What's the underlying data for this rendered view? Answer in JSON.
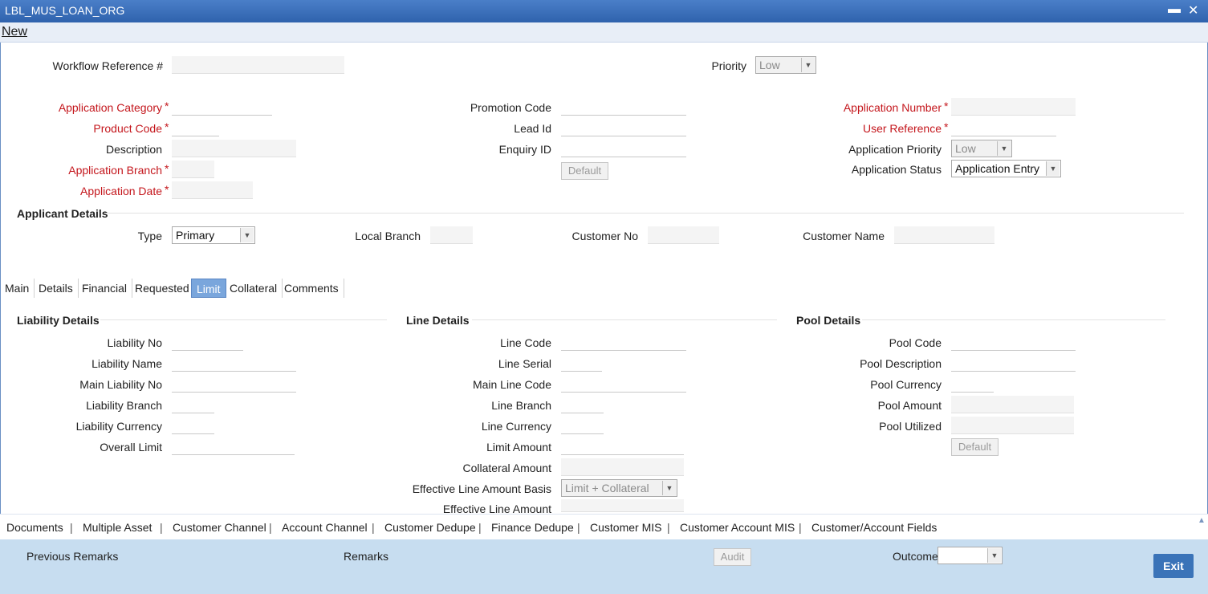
{
  "window": {
    "title": "LBL_MUS_LOAN_ORG"
  },
  "menu": {
    "new_label": "New"
  },
  "header": {
    "workflow_ref_label": "Workflow Reference #",
    "priority_label": "Priority",
    "priority_value": "Low"
  },
  "form": {
    "app_category_label": "Application Category",
    "product_code_label": "Product Code",
    "description_label": "Description",
    "app_branch_label": "Application Branch",
    "app_date_label": "Application Date",
    "promotion_code_label": "Promotion Code",
    "lead_id_label": "Lead Id",
    "enquiry_id_label": "Enquiry ID",
    "default_label": "Default",
    "app_number_label": "Application Number",
    "user_ref_label": "User Reference",
    "app_priority_label": "Application Priority",
    "app_priority_value": "Low",
    "app_status_label": "Application Status",
    "app_status_value": "Application Entry",
    "required_mark": "*"
  },
  "applicant": {
    "section_title": "Applicant Details",
    "type_label": "Type",
    "type_value": "Primary",
    "local_branch_label": "Local Branch",
    "customer_no_label": "Customer No",
    "customer_name_label": "Customer Name"
  },
  "tabs": [
    "Main",
    "Details",
    "Financial",
    "Requested",
    "Limit",
    "Collateral",
    "Comments"
  ],
  "active_tab": "Limit",
  "liability": {
    "section_title": "Liability Details",
    "liability_no": "Liability No",
    "liability_name": "Liability Name",
    "main_liability_no": "Main Liability No",
    "liability_branch": "Liability Branch",
    "liability_currency": "Liability Currency",
    "overall_limit": "Overall Limit"
  },
  "line": {
    "section_title": "Line Details",
    "line_code": "Line Code",
    "line_serial": "Line Serial",
    "main_line_code": "Main Line Code",
    "line_branch": "Line Branch",
    "line_currency": "Line Currency",
    "limit_amount": "Limit Amount",
    "collateral_amount": "Collateral Amount",
    "effective_basis": "Effective Line Amount Basis",
    "effective_basis_value": "Limit + Collateral",
    "effective_amount": "Effective Line Amount"
  },
  "pool": {
    "section_title": "Pool Details",
    "pool_code": "Pool Code",
    "pool_description": "Pool Description",
    "pool_currency": "Pool Currency",
    "pool_amount": "Pool Amount",
    "pool_utilized": "Pool Utilized",
    "default_label": "Default"
  },
  "bottom_nav": [
    "Documents",
    "Multiple Asset",
    "Customer Channel",
    "Account Channel",
    "Customer Dedupe",
    "Finance Dedupe",
    "Customer MIS",
    "Customer Account MIS",
    "Customer/Account Fields"
  ],
  "bottom_nav_separator": "|",
  "footer": {
    "previous_remarks": "Previous Remarks",
    "remarks": "Remarks",
    "audit": "Audit",
    "outcome": "Outcome",
    "exit": "Exit"
  }
}
